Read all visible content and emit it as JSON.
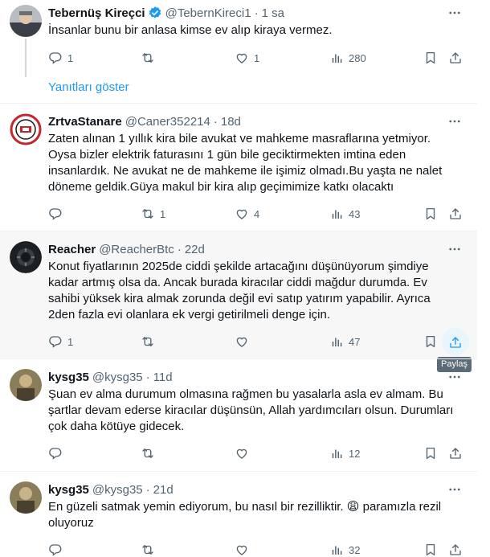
{
  "tweets": [
    {
      "name": "Tebernüş Kireçci",
      "handle": "@TebernKireci1",
      "time": "1 sa",
      "verified": true,
      "text": [
        "İnsanlar bunu bir anlasa kimse ev alıp kiraya vermez."
      ],
      "replies": "1",
      "retweets": "",
      "likes": "1",
      "views": "280",
      "show_replies": "Yanıtları göster"
    },
    {
      "name": "ZrtvaStanare",
      "handle": "@Caner352214",
      "time": "18d",
      "text": [
        "Zaten alınan 1 yıllık kira bile avukat ve mahkeme masraflarına yetmiyor.",
        "Oysa bizler elektrik faturasını 1 gün bile geciktirmekten imtina eden",
        "insanlardık. Ne avukat ne de mahkeme ile işimiz olmadı.Bu yaşta ne nalet",
        "döneme geldik.Güya makul bir kira alıp geçimimize katkı olacaktı"
      ],
      "replies": "",
      "retweets": "1",
      "likes": "4",
      "views": "43"
    },
    {
      "name": "Reacher",
      "handle": "@ReacherBtc",
      "time": "22d",
      "text": [
        "Konut fiyatlarının 2025de ciddi şekilde artacağını düşünüyorum şimdiye",
        "kadar artmış olsa da. Ancak burada kiracılar ciddi mağdur durumda. Ev",
        "sahibi yüksek kira almak zorunda değil evi satıp yatırım yapabilir. Ayrıca",
        "2den fazla evi olanlara ek vergi getirilmeli denge için."
      ],
      "replies": "1",
      "retweets": "",
      "likes": "",
      "views": "47",
      "tooltip": "Paylaş"
    },
    {
      "name": "kysg35",
      "handle": "@kysg35",
      "time": "11d",
      "text": [
        "Şuan ev alma durumum olmasına rağmen bu yasalarla asla ev almam.  Bu",
        "şartlar devam ederse kiracılar düşünsün, Allah yardımcıları olsun. Durumları",
        "çok daha kötüye gidecek."
      ],
      "replies": "",
      "retweets": "",
      "likes": "",
      "views": "12"
    },
    {
      "name": "kysg35",
      "handle": "@kysg35",
      "time": "21d",
      "text": [
        "En güzeli satmak yemin ediyorum, bu nasıl bir rezilliktir. 😩  paramızla rezil",
        "oluyoruz"
      ],
      "replies": "",
      "retweets": "",
      "likes": "",
      "views": "32"
    }
  ],
  "colors": {
    "accent": "#1d9bf0",
    "muted": "#536471",
    "text": "#0f1419"
  }
}
